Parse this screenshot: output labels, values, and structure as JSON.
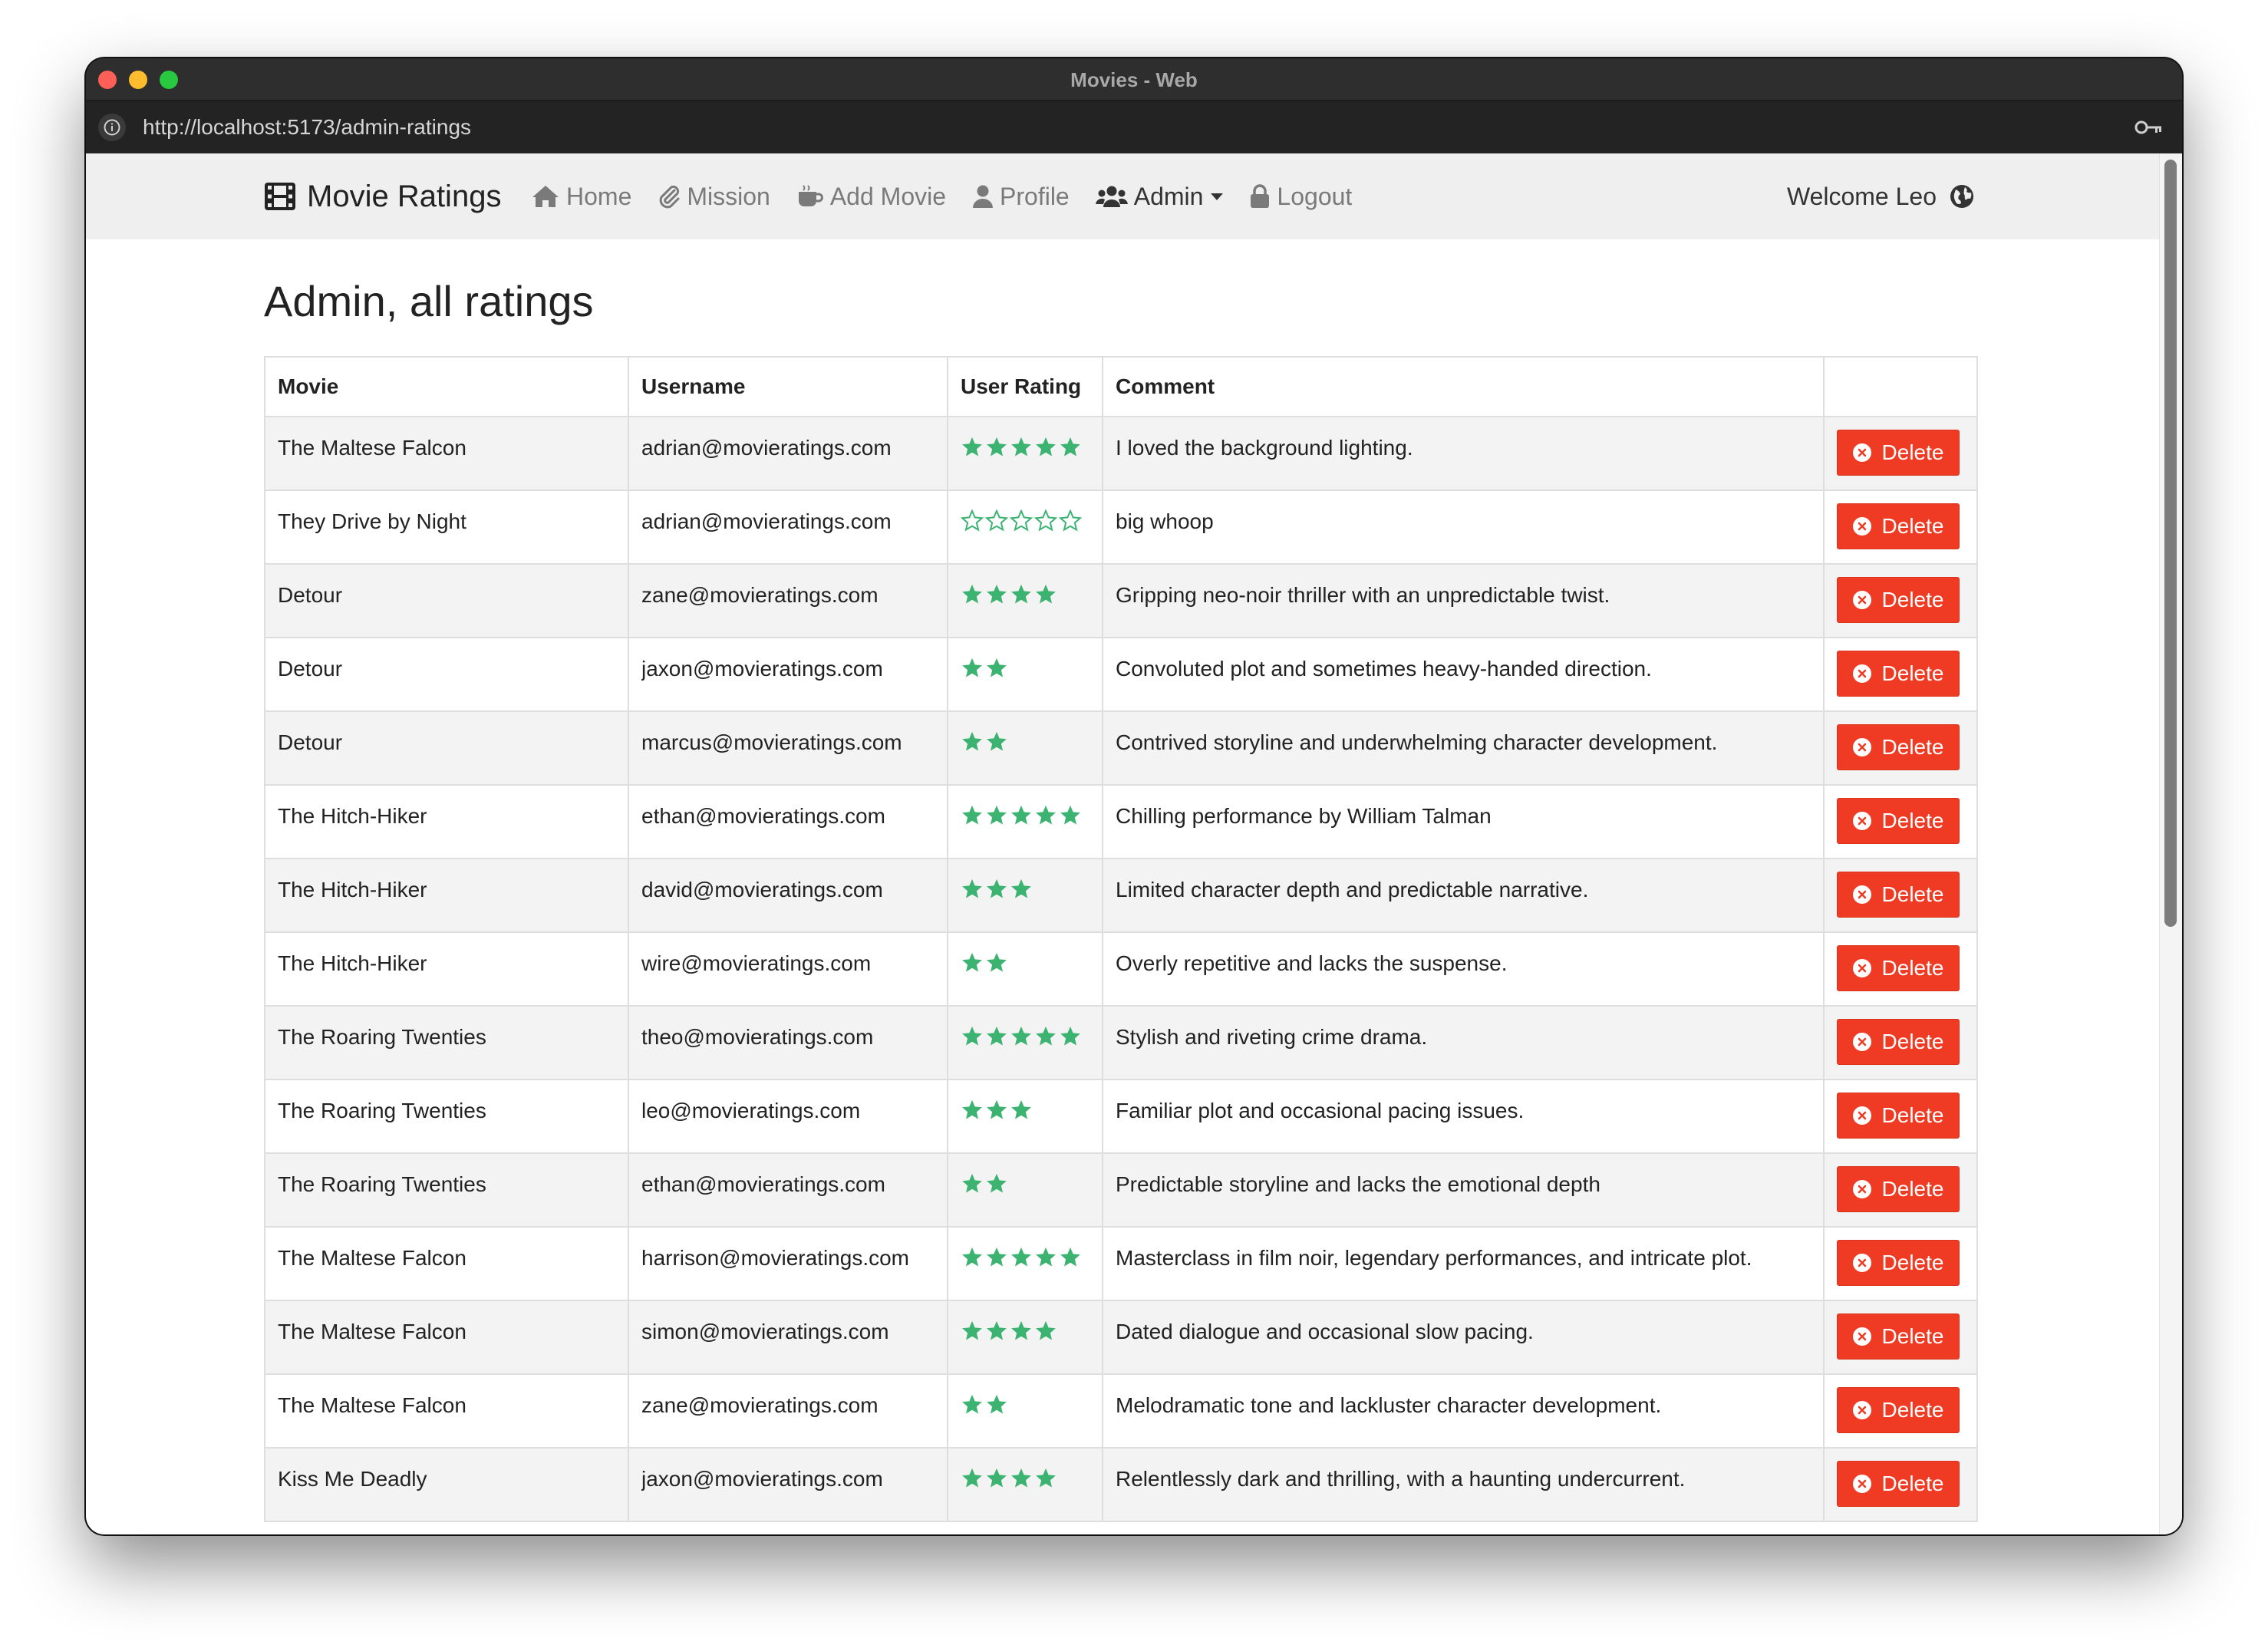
{
  "window": {
    "title": "Movies - Web"
  },
  "browser": {
    "url": "http://localhost:5173/admin-ratings"
  },
  "nav": {
    "brand": "Movie Ratings",
    "items": [
      {
        "label": "Home",
        "icon": "home-icon"
      },
      {
        "label": "Mission",
        "icon": "paperclip-icon"
      },
      {
        "label": "Add Movie",
        "icon": "coffee-cup-icon"
      },
      {
        "label": "Profile",
        "icon": "user-icon"
      },
      {
        "label": "Admin",
        "icon": "users-icon"
      },
      {
        "label": "Logout",
        "icon": "lock-icon"
      }
    ],
    "welcome": "Welcome Leo",
    "globe_icon": "globe-icon"
  },
  "page": {
    "title": "Admin, all ratings"
  },
  "table": {
    "headers": [
      "Movie",
      "Username",
      "User Rating",
      "Comment",
      ""
    ],
    "delete_label": "Delete",
    "star_color": "#3cb371",
    "delete_color": "#ef3b24",
    "rows": [
      {
        "movie": "The Maltese Falcon",
        "username": "adrian@movieratings.com",
        "rating": 5,
        "empty_stars": false,
        "comment": "I loved the background lighting."
      },
      {
        "movie": "They Drive by Night",
        "username": "adrian@movieratings.com",
        "rating": 0,
        "empty_stars": true,
        "comment": "big whoop"
      },
      {
        "movie": "Detour",
        "username": "zane@movieratings.com",
        "rating": 4,
        "empty_stars": false,
        "comment": "Gripping neo-noir thriller with an unpredictable twist."
      },
      {
        "movie": "Detour",
        "username": "jaxon@movieratings.com",
        "rating": 2,
        "empty_stars": false,
        "comment": "Convoluted plot and sometimes heavy-handed direction."
      },
      {
        "movie": "Detour",
        "username": "marcus@movieratings.com",
        "rating": 2,
        "empty_stars": false,
        "comment": "Contrived storyline and underwhelming character development."
      },
      {
        "movie": "The Hitch-Hiker",
        "username": "ethan@movieratings.com",
        "rating": 5,
        "empty_stars": false,
        "comment": "Chilling performance by William Talman"
      },
      {
        "movie": "The Hitch-Hiker",
        "username": "david@movieratings.com",
        "rating": 3,
        "empty_stars": false,
        "comment": "Limited character depth and predictable narrative."
      },
      {
        "movie": "The Hitch-Hiker",
        "username": "wire@movieratings.com",
        "rating": 2,
        "empty_stars": false,
        "comment": "Overly repetitive and lacks the suspense."
      },
      {
        "movie": "The Roaring Twenties",
        "username": "theo@movieratings.com",
        "rating": 5,
        "empty_stars": false,
        "comment": "Stylish and riveting crime drama."
      },
      {
        "movie": "The Roaring Twenties",
        "username": "leo@movieratings.com",
        "rating": 3,
        "empty_stars": false,
        "comment": "Familiar plot and occasional pacing issues."
      },
      {
        "movie": "The Roaring Twenties",
        "username": "ethan@movieratings.com",
        "rating": 2,
        "empty_stars": false,
        "comment": "Predictable storyline and lacks the emotional depth"
      },
      {
        "movie": "The Maltese Falcon",
        "username": "harrison@movieratings.com",
        "rating": 5,
        "empty_stars": false,
        "comment": "Masterclass in film noir, legendary performances, and intricate plot."
      },
      {
        "movie": "The Maltese Falcon",
        "username": "simon@movieratings.com",
        "rating": 4,
        "empty_stars": false,
        "comment": "Dated dialogue and occasional slow pacing."
      },
      {
        "movie": "The Maltese Falcon",
        "username": "zane@movieratings.com",
        "rating": 2,
        "empty_stars": false,
        "comment": "Melodramatic tone and lackluster character development."
      },
      {
        "movie": "Kiss Me Deadly",
        "username": "jaxon@movieratings.com",
        "rating": 4,
        "empty_stars": false,
        "comment": "Relentlessly dark and thrilling, with a haunting undercurrent."
      }
    ]
  }
}
